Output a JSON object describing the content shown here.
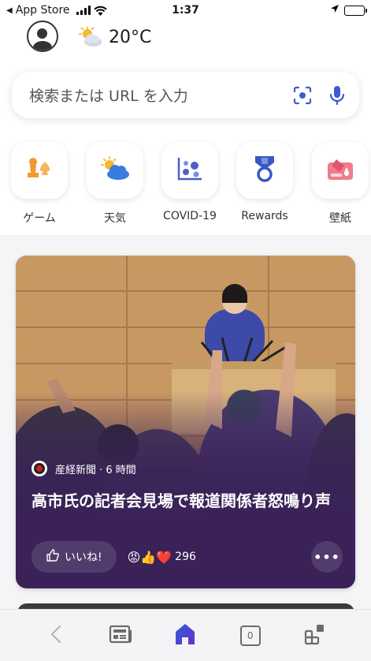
{
  "status_bar": {
    "back_app": "App Store",
    "time": "1:37"
  },
  "header": {
    "temperature": "20°C",
    "weather_icon": "partly-cloudy-icon"
  },
  "search": {
    "placeholder": "検索または URL を入力"
  },
  "quick_links": [
    {
      "label": "ゲーム",
      "icon": "games-icon",
      "color": "#f29a2e"
    },
    {
      "label": "天気",
      "icon": "weather-icon",
      "color": "#3b7be0"
    },
    {
      "label": "COVID-19",
      "icon": "covid-icon",
      "color": "#4a5fc8"
    },
    {
      "label": "Rewards",
      "icon": "rewards-icon",
      "color": "#3559c7"
    },
    {
      "label": "壁紙",
      "icon": "wallpaper-icon",
      "color": "#e0566a"
    }
  ],
  "news_card": {
    "source": "産経新聞 · 6 時間",
    "headline": "高市氏の記者会見場で報道関係者怒鳴り声",
    "like_label": "いいね!",
    "reaction_count": "296",
    "reaction_emojis": "😡👍❤️"
  },
  "bottom_bar": {
    "tab_count": "0"
  },
  "colors": {
    "card_bg": "#3a2258",
    "accent": "#3d5bd6",
    "home_icon": "#3b3fd6"
  }
}
